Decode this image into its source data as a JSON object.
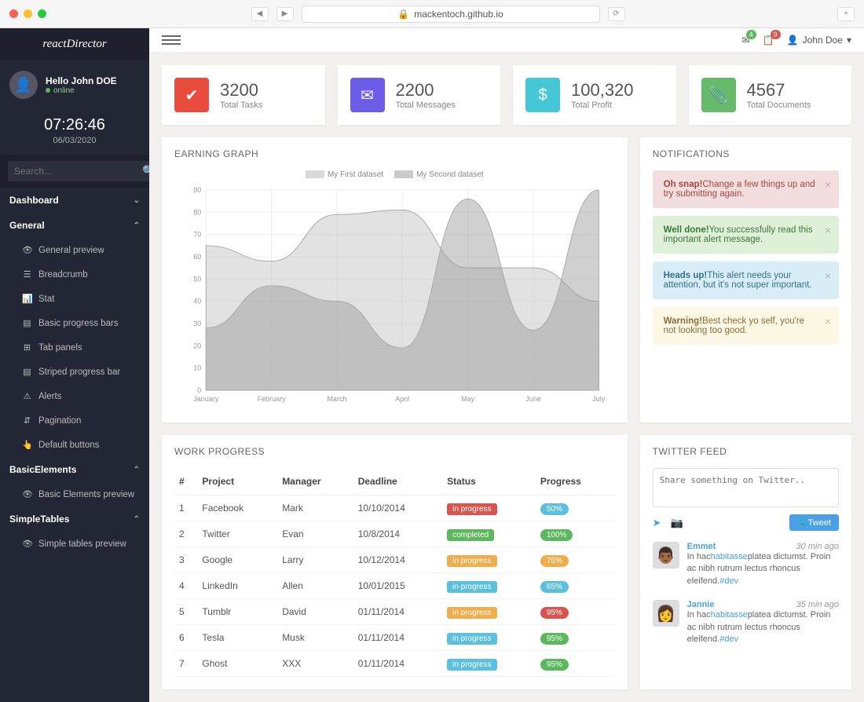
{
  "browser": {
    "url": "mackentoch.github.io"
  },
  "brand": "reactDirector",
  "profile": {
    "greeting": "Hello John DOE",
    "status": "online"
  },
  "clock": {
    "time": "07:26:46",
    "date": "06/03/2020"
  },
  "search": {
    "placeholder": "Search..."
  },
  "sidebar": {
    "cats": [
      {
        "label": "Dashboard",
        "open": false
      },
      {
        "label": "General",
        "open": true
      },
      {
        "label": "BasicElements",
        "open": true
      },
      {
        "label": "SimpleTables",
        "open": true
      }
    ],
    "general": [
      {
        "icon": "eye",
        "label": "General preview"
      },
      {
        "icon": "list",
        "label": "Breadcrumb"
      },
      {
        "icon": "chart",
        "label": "Stat"
      },
      {
        "icon": "bars",
        "label": "Basic progress bars"
      },
      {
        "icon": "tab",
        "label": "Tab panels"
      },
      {
        "icon": "bars",
        "label": "Striped progress bar"
      },
      {
        "icon": "alert",
        "label": "Alerts"
      },
      {
        "icon": "sort",
        "label": "Pagination"
      },
      {
        "icon": "hand",
        "label": "Default buttons"
      }
    ],
    "basic": [
      {
        "icon": "eye",
        "label": "Basic Elements preview"
      }
    ],
    "tables": [
      {
        "icon": "eye",
        "label": "Simple tables preview"
      }
    ]
  },
  "topnav": {
    "mail_badge": "4",
    "notif_badge": "9",
    "user": "John Doe"
  },
  "stats": [
    {
      "value": "3200",
      "label": "Total Tasks",
      "icon": "check",
      "color": "#e74c3c"
    },
    {
      "value": "2200",
      "label": "Total Messages",
      "icon": "mail",
      "color": "#6c5ce7"
    },
    {
      "value": "100,320",
      "label": "Total Profit",
      "icon": "dollar",
      "color": "#45c7d8"
    },
    {
      "value": "4567",
      "label": "Total Documents",
      "icon": "clip",
      "color": "#66bb6a"
    }
  ],
  "earning": {
    "title": "EARNING GRAPH"
  },
  "notifications": {
    "title": "NOTIFICATIONS",
    "items": [
      {
        "type": "danger",
        "strong": "Oh snap!",
        "text": "Change a few things up and try submitting again."
      },
      {
        "type": "success",
        "strong": "Well done!",
        "text": "You successfully read this important alert message."
      },
      {
        "type": "info",
        "strong": "Heads up!",
        "text": "This alert needs your attention, but it's not super important."
      },
      {
        "type": "warning",
        "strong": "Warning!",
        "text": "Best check yo self, you're not looking too good."
      }
    ]
  },
  "work": {
    "title": "WORK PROGRESS",
    "headers": [
      "#",
      "Project",
      "Manager",
      "Deadline",
      "Status",
      "Progress"
    ],
    "rows": [
      {
        "n": "1",
        "project": "Facebook",
        "manager": "Mark",
        "deadline": "10/10/2014",
        "status": "in progress",
        "status_color": "#d9534f",
        "progress": "50%",
        "progress_color": "#5bc0de"
      },
      {
        "n": "2",
        "project": "Twitter",
        "manager": "Evan",
        "deadline": "10/8/2014",
        "status": "completed",
        "status_color": "#5cb85c",
        "progress": "100%",
        "progress_color": "#5cb85c"
      },
      {
        "n": "3",
        "project": "Google",
        "manager": "Larry",
        "deadline": "10/12/2014",
        "status": "in progress",
        "status_color": "#f0ad4e",
        "progress": "75%",
        "progress_color": "#f0ad4e"
      },
      {
        "n": "4",
        "project": "LinkedIn",
        "manager": "Allen",
        "deadline": "10/01/2015",
        "status": "in progress",
        "status_color": "#5bc0de",
        "progress": "65%",
        "progress_color": "#5bc0de"
      },
      {
        "n": "5",
        "project": "Tumblr",
        "manager": "David",
        "deadline": "01/11/2014",
        "status": "in progress",
        "status_color": "#f0ad4e",
        "progress": "95%",
        "progress_color": "#d9534f"
      },
      {
        "n": "6",
        "project": "Tesla",
        "manager": "Musk",
        "deadline": "01/11/2014",
        "status": "in progress",
        "status_color": "#5bc0de",
        "progress": "95%",
        "progress_color": "#5cb85c"
      },
      {
        "n": "7",
        "project": "Ghost",
        "manager": "XXX",
        "deadline": "01/11/2014",
        "status": "in progress",
        "status_color": "#5bc0de",
        "progress": "95%",
        "progress_color": "#5cb85c"
      }
    ]
  },
  "twitter": {
    "title": "TWITTER FEED",
    "placeholder": "Share something on Twitter..",
    "button": "Tweet",
    "feed": [
      {
        "name": "Emmet",
        "time": "30 min ago",
        "text1": "In hac",
        "link1": "habitasse",
        "text2": "platea dictumst. Proin ac nibh rutrum lectus rhoncus eleifend.",
        "tag": "#dev"
      },
      {
        "name": "Jannie",
        "time": "35 min ago",
        "text1": "In hac",
        "link1": "habitasse",
        "text2": "platea dictumst. Proin ac nibh rutrum lectus rhoncus eleifend.",
        "tag": "#dev"
      }
    ]
  },
  "chart_data": {
    "type": "area",
    "title": "EARNING GRAPH",
    "xlabel": "",
    "ylabel": "",
    "x": [
      "January",
      "February",
      "March",
      "April",
      "May",
      "June",
      "July"
    ],
    "ylim": [
      0,
      90
    ],
    "yticks": [
      0,
      10,
      20,
      30,
      40,
      50,
      60,
      70,
      80,
      90
    ],
    "legend": [
      "My First dataset",
      "My Second dataset"
    ],
    "series": [
      {
        "name": "My First dataset",
        "values": [
          65,
          58,
          79,
          81,
          55,
          55,
          40
        ]
      },
      {
        "name": "My Second dataset",
        "values": [
          28,
          47,
          40,
          19,
          86,
          27,
          90
        ]
      }
    ]
  }
}
